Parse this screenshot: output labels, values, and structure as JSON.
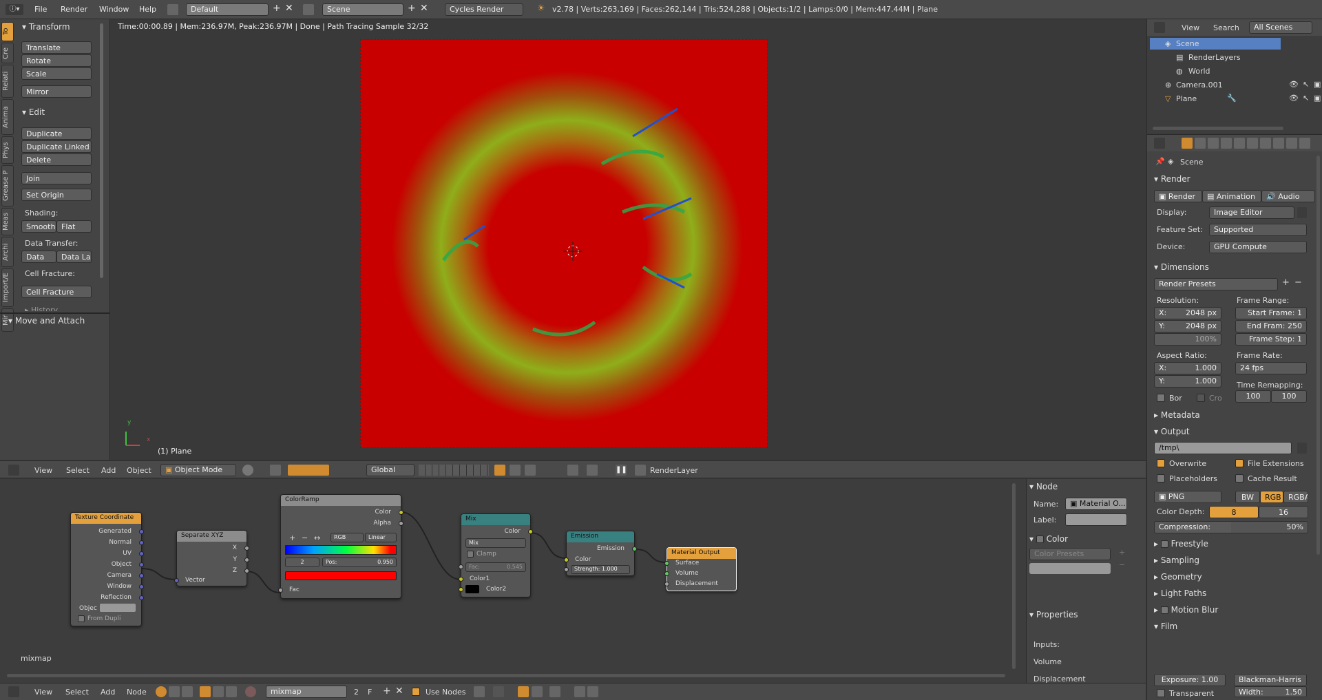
{
  "topbar": {
    "menus": [
      "File",
      "Render",
      "Window",
      "Help"
    ],
    "screen_layout": "Default",
    "scene": "Scene",
    "engine": "Cycles Render",
    "stats": "v2.78 | Verts:263,169 | Faces:262,144 | Tris:524,288 | Objects:1/2 | Lamps:0/0 | Mem:447.44M | Plane"
  },
  "toolshelf": {
    "tabs": [
      "To",
      "Cre",
      "Relati",
      "Anima",
      "Phys",
      "Grease P",
      "Meas",
      "Archi",
      "Import/E",
      "Mir"
    ],
    "transform_header": "Transform",
    "transform": [
      "Translate",
      "Rotate",
      "Scale",
      "Mirror"
    ],
    "edit_header": "Edit",
    "edit": [
      "Duplicate",
      "Duplicate Linked",
      "Delete",
      "Join",
      "Set Origin"
    ],
    "shading_label": "Shading:",
    "smooth": "Smooth",
    "flat": "Flat",
    "data_transfer_label": "Data Transfer:",
    "data": "Data",
    "data_la": "Data La",
    "cell_fracture_label": "Cell Fracture:",
    "cell_fracture": "Cell Fracture",
    "history": "History",
    "move_attach": "Move and Attach"
  },
  "viewport": {
    "status": "Time:00:00.89 | Mem:236.97M, Peak:236.97M | Done | Path Tracing Sample 32/32",
    "object_label": "(1) Plane",
    "axis_x": "x",
    "axis_y": "y",
    "header": {
      "menus": [
        "View",
        "Select",
        "Add",
        "Object"
      ],
      "mode": "Object Mode",
      "orientation": "Global",
      "render_layer": "RenderLayer"
    }
  },
  "outliner": {
    "header": [
      "View",
      "Search",
      "All Scenes"
    ],
    "items": [
      "Scene",
      "RenderLayers",
      "World",
      "Camera.001",
      "Plane"
    ]
  },
  "properties": {
    "breadcrumb": "Scene",
    "render_header": "Render",
    "render_btn": "Render",
    "animation_btn": "Animation",
    "audio_btn": "Audio",
    "display_label": "Display:",
    "display_value": "Image Editor",
    "feature_label": "Feature Set:",
    "feature_value": "Supported",
    "device_label": "Device:",
    "device_value": "GPU Compute",
    "dimensions_header": "Dimensions",
    "render_presets": "Render Presets",
    "resolution_label": "Resolution:",
    "res_x": "X:",
    "res_x_val": "2048 px",
    "res_y": "Y:",
    "res_y_val": "2048 px",
    "res_pct": "100%",
    "frame_range_label": "Frame Range:",
    "start_frame": "Start Frame: 1",
    "end_frame": "End Fram: 250",
    "frame_step": "Frame Step: 1",
    "aspect_label": "Aspect Ratio:",
    "asp_x": "X:",
    "asp_x_val": "1.000",
    "asp_y": "Y:",
    "asp_y_val": "1.000",
    "frame_rate_label": "Frame Rate:",
    "frame_rate": "24 fps",
    "time_remap_label": "Time Remapping:",
    "remap_old": "100",
    "remap_new": "100",
    "bor": "Bor",
    "cro": "Cro",
    "metadata_header": "Metadata",
    "output_header": "Output",
    "output_path": "/tmp\\",
    "overwrite": "Overwrite",
    "file_ext": "File Extensions",
    "placeholders": "Placeholders",
    "cache_result": "Cache Result",
    "format": "PNG",
    "bw": "BW",
    "rgb": "RGB",
    "rgba": "RGBA",
    "color_depth_label": "Color Depth:",
    "depth_8": "8",
    "depth_16": "16",
    "compression": "Compression:",
    "compression_val": "50%",
    "freestyle": "Freestyle",
    "sampling": "Sampling",
    "geometry": "Geometry",
    "light_paths": "Light Paths",
    "motion_blur": "Motion Blur",
    "film": "Film",
    "exposure": "Exposure: 1.00",
    "filter": "Blackman-Harris",
    "transparent": "Transparent",
    "width": "Width:",
    "width_val": "1.50"
  },
  "node_editor": {
    "material_name": "mixmap",
    "nodes": {
      "texcoord": {
        "title": "Texture Coordinate",
        "outputs": [
          "Generated",
          "Normal",
          "UV",
          "Object",
          "Camera",
          "Window",
          "Reflection"
        ],
        "object_label": "Objec",
        "from_dupli": "From Dupli"
      },
      "sepxyz": {
        "title": "Separate XYZ",
        "outputs": [
          "X",
          "Y",
          "Z"
        ],
        "input": "Vector"
      },
      "colorramp": {
        "title": "ColorRamp",
        "out_color": "Color",
        "out_alpha": "Alpha",
        "mode": "RGB",
        "interp": "Linear",
        "index": "2",
        "pos_label": "Pos:",
        "pos": "0.950",
        "input": "Fac"
      },
      "mix": {
        "title": "Mix",
        "out": "Color",
        "blend": "Mix",
        "clamp": "Clamp",
        "fac": "Fac:",
        "fac_val": "0.545",
        "color1": "Color1",
        "color2": "Color2"
      },
      "emission": {
        "title": "Emission",
        "out": "Emission",
        "color": "Color",
        "strength": "Strength:",
        "strength_val": "1.000"
      },
      "matout": {
        "title": "Material Output",
        "inputs": [
          "Surface",
          "Volume",
          "Displacement"
        ]
      }
    },
    "sidebar": {
      "node_header": "Node",
      "name_label": "Name:",
      "name_value": "Material O...",
      "label_label": "Label:",
      "color_header": "Color",
      "color_presets": "Color Presets",
      "properties_header": "Properties",
      "inputs": "Inputs:",
      "volume": "Volume",
      "displacement": "Displacement"
    },
    "header": {
      "menus": [
        "View",
        "Select",
        "Add",
        "Node"
      ],
      "material": "mixmap",
      "users": "2",
      "fake": "F",
      "use_nodes": "Use Nodes"
    }
  },
  "colors": {
    "render_bg": "#c80000",
    "accent": "#e3a03c",
    "selected_blue": "#5680c2"
  }
}
